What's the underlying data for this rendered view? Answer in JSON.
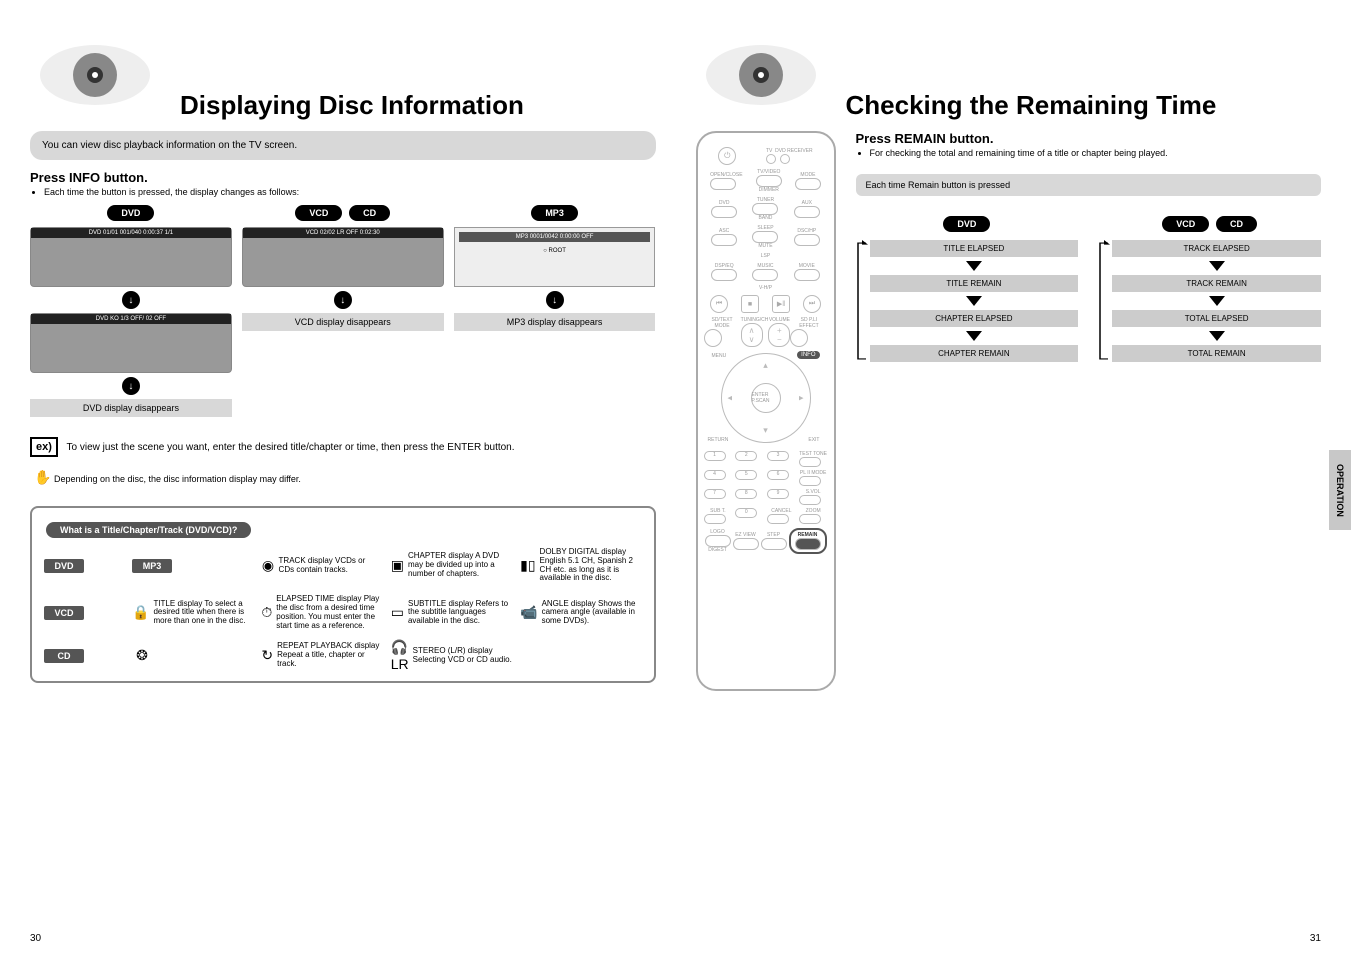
{
  "page_left": "30",
  "page_right": "31",
  "side_tab": "OPERATION",
  "left": {
    "title": "Displaying Disc Information",
    "intro": "You can view disc playback information on the TV screen.",
    "action": "Press INFO button.",
    "sub": "Each time the button is pressed, the display changes as follows:",
    "discs": [
      "DVD",
      "VCD",
      "CD",
      "MP3"
    ],
    "captions": {
      "dvd2": "DVD display\ndisappears",
      "vcd": "VCD display\ndisappears",
      "mp3": "MP3 display\ndisappears"
    },
    "osd": {
      "dvd1": "DVD   01/01   001/040   0:00:37   1/1",
      "dvd2": "DVD   KO 1/3   OFF/ 02   OFF",
      "vcd": "VCD   02/02   LR   OFF   0:02:30",
      "mp3": "MP3   0001/0042   0:00:00   OFF",
      "mp3_root": "ROOT"
    },
    "example_label": "ex)",
    "example_text": "To view just the scene you want, enter the desired title/chapter or time, then press the ENTER button.",
    "note_icon_text": "Depending on the disc, the disc information display may differ.",
    "legend_title": "What is a Title/Chapter/Track (DVD/VCD)?",
    "legend": {
      "dvd_tag": "DVD",
      "vcd_tag": "VCD",
      "cd_tag": "CD",
      "mp3_tag": "MP3",
      "items": [
        {
          "icon": "title-icon",
          "label": "TITLE display\nTo select a desired title when there is more than one in the disc."
        },
        {
          "icon": "track-icon",
          "label": "TRACK display\nVCDs or CDs contain tracks."
        },
        {
          "icon": "time-icon",
          "label": "ELAPSED TIME display\nPlay the disc from a desired time position. You must enter the start time as a reference."
        },
        {
          "icon": "chapter-icon",
          "label": "CHAPTER display\nA DVD may be divided up into a number of chapters."
        },
        {
          "icon": "subtitle-icon",
          "label": "SUBTITLE display\nRefers to the subtitle languages available in the disc."
        },
        {
          "icon": "audio-lr-icon",
          "label": "STEREO (L/R) display\nSelecting VCD or CD audio."
        },
        {
          "icon": "dolby-icon",
          "label": "DOLBY DIGITAL display\nEnglish 5.1 CH, Spanish 2 CH etc. as long as it is available in the disc."
        },
        {
          "icon": "angle-icon",
          "label": "ANGLE display\nShows the camera angle (available in some DVDs)."
        },
        {
          "icon": "repeat-icon",
          "label": "REPEAT PLAYBACK display\nRepeat a title, chapter or track."
        }
      ]
    }
  },
  "right": {
    "title": "Checking the Remaining Time",
    "action": "Press REMAIN button.",
    "sub": "For checking the total and remaining time of a title or chapter being played.",
    "remain_header": "Each time Remain button is pressed",
    "col1_label": "DVD",
    "col1_steps": [
      "TITLE ELAPSED",
      "TITLE REMAIN",
      "CHAPTER ELAPSED",
      "CHAPTER REMAIN"
    ],
    "col2_labels": [
      "VCD",
      "CD"
    ],
    "col2_steps": [
      "TRACK ELAPSED",
      "TRACK REMAIN",
      "TOTAL ELAPSED",
      "TOTAL REMAIN"
    ],
    "remote": {
      "power": "⏻",
      "mode_labels": [
        "TV",
        "DVD RECEIVER"
      ],
      "row1": [
        "OPEN/CLOSE",
        "TV/VIDEO",
        "MODE"
      ],
      "row1b": [
        "",
        "DIMMER",
        ""
      ],
      "row2": [
        "DVD",
        "TUNER",
        "AUX"
      ],
      "row2b": [
        "",
        "BAND",
        ""
      ],
      "row3": [
        "ASC",
        "SLEEP",
        "DSC/HP"
      ],
      "row3b": [
        "",
        "MUTE",
        ""
      ],
      "row4": [
        "DSP/EQ",
        "MUSIC",
        "MOVIE"
      ],
      "row4_top": "LSP",
      "trans": [
        "⏮",
        "■",
        "▶‖",
        "⏭"
      ],
      "trans_sub": "V-H/P",
      "tuning_l": "SD/TEXT MODE",
      "tuning_r": "SD P.LI EFFECT",
      "tuning_label": "TUNING/CH",
      "volume_label": "VOLUME",
      "shoulder_l": "MENU",
      "shoulder_r": "INFO",
      "shoulder_bl": "RETURN",
      "shoulder_br": "EXIT",
      "dpad_center": "ENTER P.SCAN",
      "num_side": [
        "TEST TONE",
        "PL II MODE",
        "S.VOL",
        "ZOOM"
      ],
      "bottom_row": [
        "LOGO",
        "EZ VIEW",
        "STEP",
        "REMAIN"
      ],
      "bottom_sub": [
        "DIGEST",
        "",
        "",
        ""
      ],
      "extra": [
        "SUB T.",
        "0",
        "CANCEL"
      ],
      "remain_highlight": "REMAIN"
    }
  }
}
